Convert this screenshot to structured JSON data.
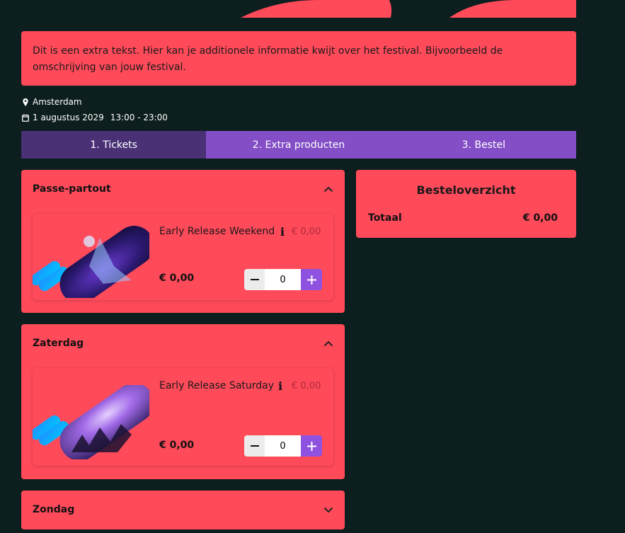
{
  "intro": {
    "text": "Dit is een extra tekst. Hier kan je additionele informatie kwijt over het festival. Bijvoorbeeld de omschrijving van jouw festival."
  },
  "event": {
    "location": "Amsterdam",
    "date": "1 augustus 2029",
    "time": "13:00 - 23:00"
  },
  "steps": [
    {
      "label": "1. Tickets",
      "active": true
    },
    {
      "label": "2. Extra producten",
      "active": false
    },
    {
      "label": "3. Bestel",
      "active": false
    }
  ],
  "sections": [
    {
      "title": "Passe-partout",
      "expanded": true,
      "ticket": {
        "name": "Early Release Weekend",
        "original_price": "€ 0,00",
        "price": "€ 0,00",
        "quantity": "0"
      }
    },
    {
      "title": "Zaterdag",
      "expanded": true,
      "ticket": {
        "name": "Early Release Saturday",
        "original_price": "€ 0,00",
        "price": "€ 0,00",
        "quantity": "0"
      }
    },
    {
      "title": "Zondag",
      "expanded": false
    }
  ],
  "summary": {
    "title": "Besteloverzicht",
    "total_label": "Totaal",
    "total_value": "€ 0,00"
  },
  "colors": {
    "background": "#0c1e1d",
    "card": "#ff4a5a",
    "step_active": "#4a3176",
    "step_inactive": "#834ec6",
    "plus_button": "#8f52e0"
  },
  "icons": {
    "location": "map-pin-icon",
    "date": "calendar-icon",
    "collapse": "chevron-up-icon",
    "expand": "chevron-down-icon",
    "info": "info-icon",
    "decrement": "minus-icon",
    "increment": "plus-icon"
  }
}
